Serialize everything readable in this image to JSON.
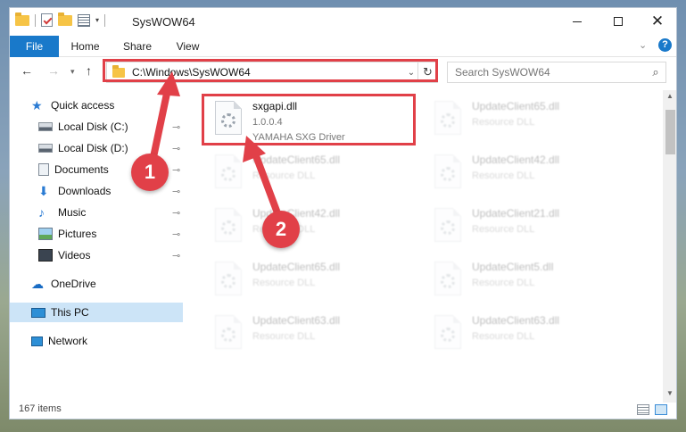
{
  "window": {
    "title": "SysWOW64",
    "minimize_glyph": "",
    "maximize_glyph": "",
    "close_glyph": "✕"
  },
  "ribbon": {
    "tabs": [
      "File",
      "Home",
      "Share",
      "View"
    ],
    "expand_glyph": "⌄",
    "help_glyph": "?"
  },
  "nav": {
    "back_glyph": "←",
    "forward_glyph": "→",
    "recent_glyph": "▾",
    "up_glyph": "↑",
    "address": "C:\\Windows\\SysWOW64",
    "address_drop_glyph": "⌄",
    "refresh_glyph": "↻",
    "search_placeholder": "Search SysWOW64",
    "search_glyph": "⌕"
  },
  "sidebar": {
    "items": [
      {
        "label": "Quick access",
        "icon": "star-icon",
        "pinned": false
      },
      {
        "label": "Local Disk (C:)",
        "icon": "disk-icon",
        "pinned": true
      },
      {
        "label": "Local Disk (D:)",
        "icon": "disk-icon",
        "pinned": true
      },
      {
        "label": "Documents",
        "icon": "documents-icon",
        "pinned": true
      },
      {
        "label": "Downloads",
        "icon": "download-icon",
        "pinned": true
      },
      {
        "label": "Music",
        "icon": "music-icon",
        "pinned": true
      },
      {
        "label": "Pictures",
        "icon": "pictures-icon",
        "pinned": true
      },
      {
        "label": "Videos",
        "icon": "videos-icon",
        "pinned": true
      },
      {
        "label": "OneDrive",
        "icon": "onedrive-icon",
        "pinned": false
      },
      {
        "label": "This PC",
        "icon": "computer-icon",
        "pinned": false,
        "selected": true
      },
      {
        "label": "Network",
        "icon": "network-icon",
        "pinned": false
      }
    ],
    "pin_glyph": "📌"
  },
  "files": {
    "highlighted": {
      "name": "sxgapi.dll",
      "version": "1.0.0.4",
      "description": "YAMAHA SXG Driver"
    },
    "faded": [
      {
        "name": "UpdateClient65.dll",
        "description": "Resource DLL"
      },
      {
        "name": "UpdateClient65.dll",
        "description": "Resource DLL"
      },
      {
        "name": "UpdateClient42.dll",
        "description": "Resource DLL"
      },
      {
        "name": "UpdateClient42.dll",
        "description": "Resource DLL"
      },
      {
        "name": "UpdateClient21.dll",
        "description": "Resource DLL"
      },
      {
        "name": "UpdateClient65.dll",
        "description": "Resource DLL"
      },
      {
        "name": "UpdateClient5.dll",
        "description": "Resource DLL"
      },
      {
        "name": "UpdateClient63.dll",
        "description": "Resource DLL"
      },
      {
        "name": "UpdateClient63.dll",
        "description": "Resource DLL"
      }
    ]
  },
  "status": {
    "item_count": "167 items"
  },
  "annotations": {
    "step1": "1",
    "step2": "2",
    "color": "#e14048"
  }
}
